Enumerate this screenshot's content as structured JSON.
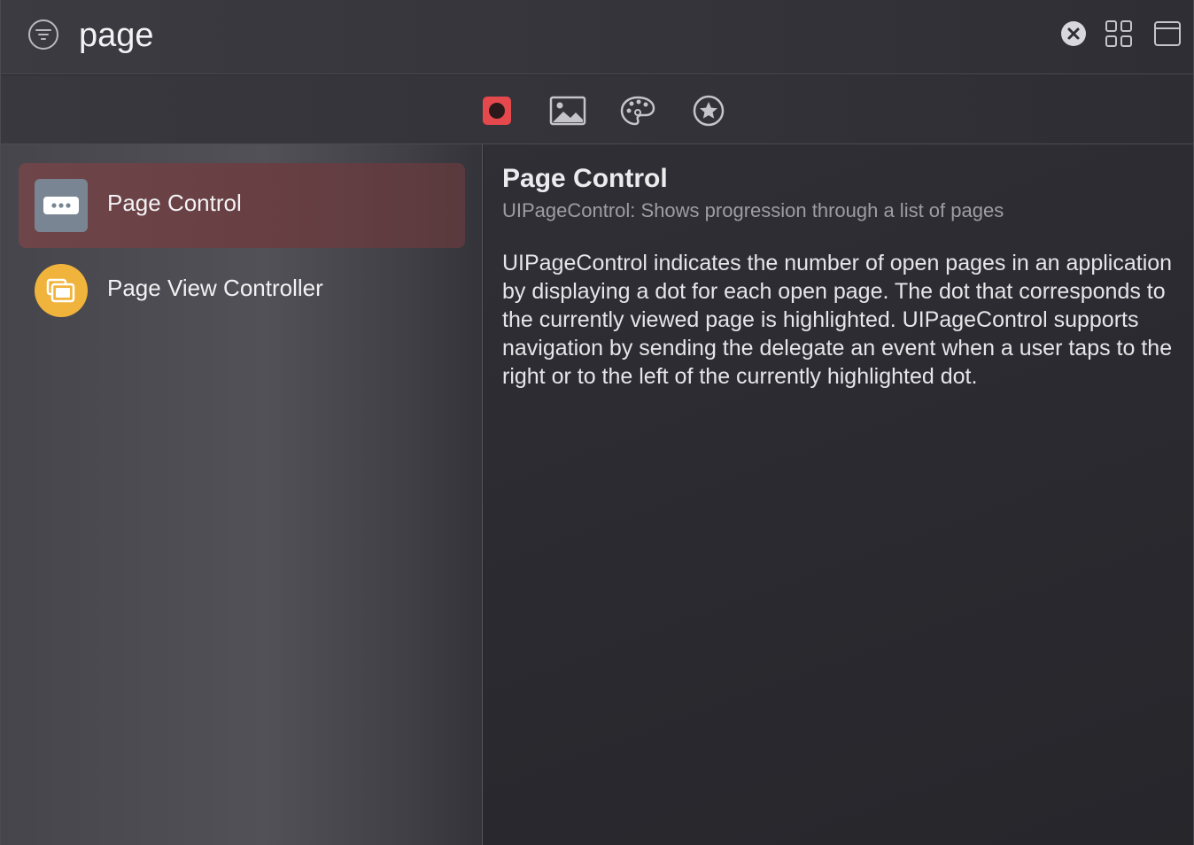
{
  "search": {
    "query": "page",
    "filter_icon": "filter-lines-icon",
    "clear_icon": "clear-circle-x-icon",
    "grid_icon": "grid-view-icon",
    "window_icon": "window-panel-icon"
  },
  "tabs": [
    {
      "name": "views",
      "icon": "view-record-icon",
      "selected": true,
      "color": "#e5484d"
    },
    {
      "name": "media",
      "icon": "image-icon",
      "selected": false
    },
    {
      "name": "colors",
      "icon": "palette-icon",
      "selected": false
    },
    {
      "name": "symbols",
      "icon": "star-circle-icon",
      "selected": false
    }
  ],
  "results": [
    {
      "label": "Page Control",
      "icon": "page-control-icon",
      "selected": true,
      "icon_color": "#7a8594"
    },
    {
      "label": "Page View Controller",
      "icon": "page-view-controller-icon",
      "selected": false,
      "icon_color": "#f0b43c"
    }
  ],
  "detail": {
    "title": "Page Control",
    "subtitle": "UIPageControl: Shows progression through a list of pages",
    "body": "UIPageControl indicates the number of open pages in an application by displaying a dot for each open page. The dot that corresponds to the currently viewed page is highlighted. UIPageControl supports navigation by sending the delegate an event when a user taps to the right or to the left of the currently highlighted dot."
  }
}
